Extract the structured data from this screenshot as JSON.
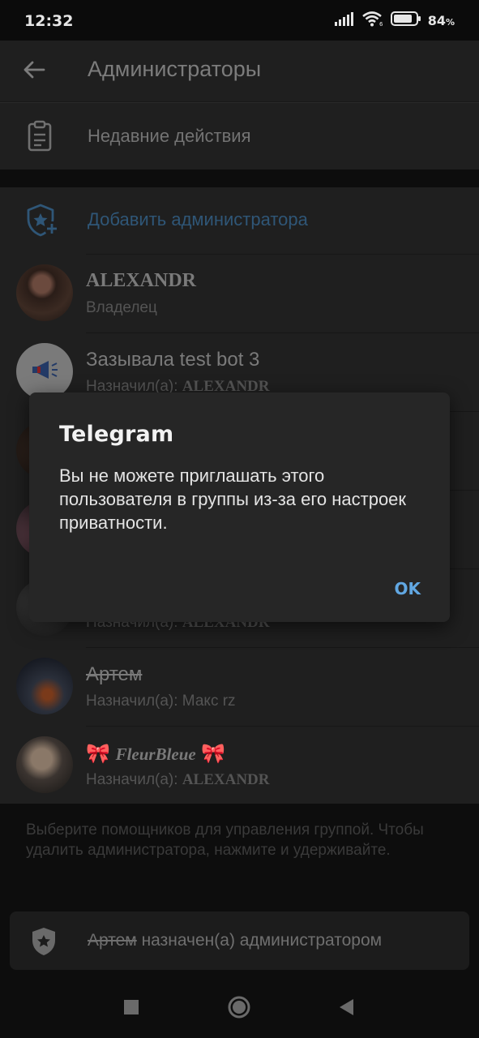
{
  "status_bar": {
    "time": "12:32",
    "battery_text": "84",
    "battery_percent_sign": "%",
    "battery_level": 0.84,
    "icons": [
      "signal-icon",
      "wifi-icon",
      "battery-icon"
    ]
  },
  "header": {
    "title": "Администраторы",
    "back_icon": "arrow-left-icon"
  },
  "recent_actions": {
    "label": "Недавние действия",
    "icon": "clipboard-icon"
  },
  "add_admin": {
    "label": "Добавить администратора",
    "icon": "shield-star-plus-icon",
    "color": "#2f5677"
  },
  "members": [
    {
      "name": "ALEXANDR",
      "subtitle": "Владелец"
    },
    {
      "name": "Зазывала test bot 3",
      "subtitle_prefix": "Назначил(а): ",
      "subtitle_name": "ALEXANDR"
    },
    {
      "name": "",
      "subtitle": ""
    },
    {
      "name": "",
      "subtitle": ""
    },
    {
      "name": "",
      "subtitle_prefix": "Назначил(а): ",
      "subtitle_name": "ALEXANDR"
    },
    {
      "name": "Артем",
      "subtitle": "Назначил(а): Макс rz"
    },
    {
      "name_prefix": "🎀 ",
      "name": "FleurBleue",
      "name_suffix": " 🎀",
      "subtitle_prefix": "Назначил(а): ",
      "subtitle_name": "ALEXANDR"
    }
  ],
  "hint_text": "Выберите помощников для управления группой. Чтобы удалить администратора, нажмите и удерживайте.",
  "toast": {
    "name": "Артем",
    "text": " назначен(а) администратором",
    "icon": "shield-star-icon"
  },
  "dialog": {
    "title": "Telegram",
    "message": "Вы не можете приглашать этого пользователя в группы из-за его настроек приватности.",
    "ok_label": "OK",
    "accent": "#61a7e2"
  },
  "nav_bar": {
    "icons": [
      "recents-square-icon",
      "home-circle-icon",
      "back-triangle-icon"
    ]
  }
}
